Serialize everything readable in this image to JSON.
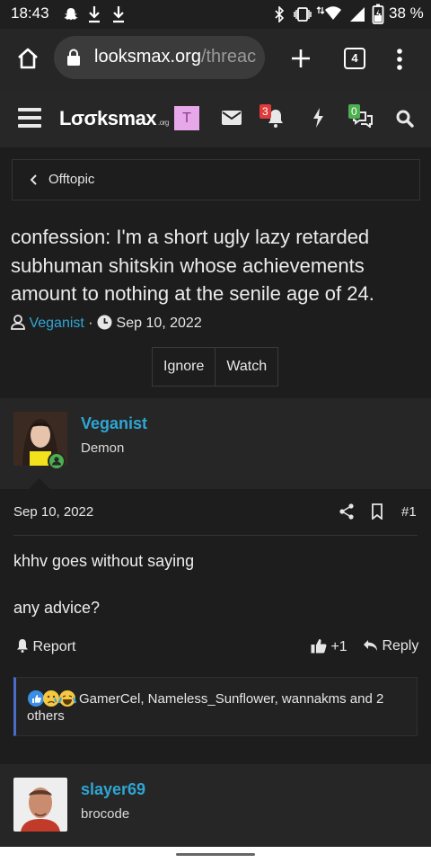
{
  "status_bar": {
    "time": "18:43",
    "battery_percent": "38 %"
  },
  "browser": {
    "url_host": "looksmax.org",
    "url_path": "/threac",
    "tab_count": "4"
  },
  "site": {
    "logo_text": "Lσσksmax",
    "logo_suffix": ".org",
    "user_initial": "T",
    "alerts_count": "3",
    "conversations_count": "0"
  },
  "breadcrumb": {
    "label": "Offtopic"
  },
  "thread": {
    "title": "confession: I'm a short ugly lazy retarded subhuman shitskin whose achievements amount to nothing at the senile age of 24.",
    "author": "Veganist",
    "date": "Sep 10, 2022",
    "ignore_label": "Ignore",
    "watch_label": "Watch"
  },
  "post": {
    "author": "Veganist",
    "role": "Demon",
    "date": "Sep 10, 2022",
    "number": "#1",
    "body_line1": "khhv goes without saying",
    "body_line2": "any advice?",
    "report_label": "Report",
    "like_label": "+1",
    "reply_label": "Reply",
    "reactions_line1": "GamerCel, Nameless_Sunflower, wannakms and 2",
    "reactions_line2": "others"
  },
  "next_post": {
    "author": "slayer69",
    "role": "brocode"
  },
  "colors": {
    "accent": "#2ea6d4",
    "badge_red": "#e03a3a",
    "badge_green": "#4caf50",
    "avatar_t": "#e6a8e8"
  }
}
